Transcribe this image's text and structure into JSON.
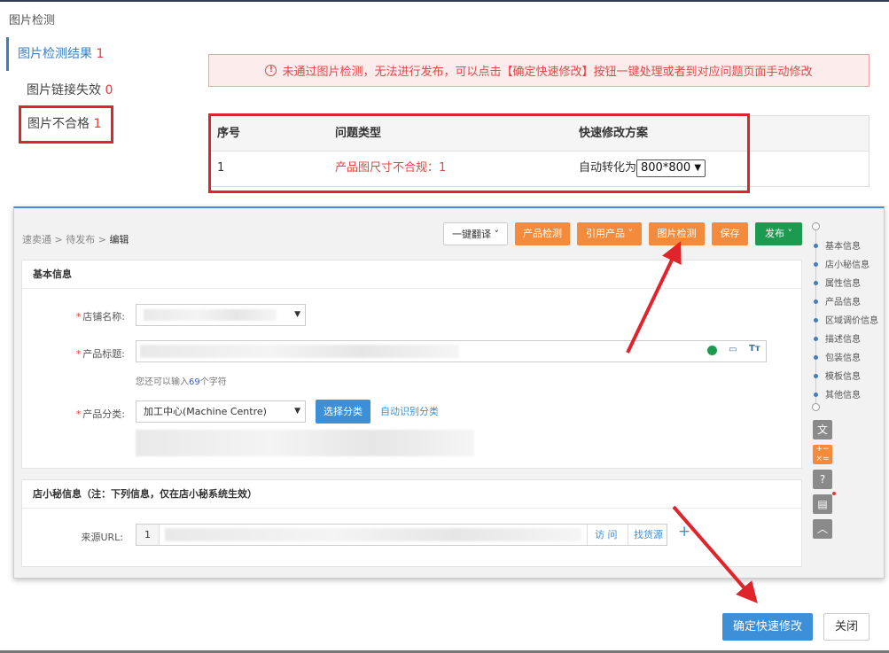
{
  "dialog": {
    "title": "图片检测",
    "nav": {
      "result_label": "图片检测结果",
      "result_count": "1",
      "link_fail_label": "图片链接失效",
      "link_fail_count": "0",
      "unqualified_label": "图片不合格",
      "unqualified_count": "1"
    },
    "alert": "未通过图片检测，无法进行发布，可以点击【确定快速修改】按钮一键处理或者到对应问题页面手动修改",
    "table": {
      "headers": [
        "序号",
        "问题类型",
        "快速修改方案"
      ],
      "rows": [
        {
          "index": "1",
          "issue": "产品图尺寸不合规：1",
          "fix_prefix": "自动转化为",
          "fix_value": "800*800"
        }
      ]
    },
    "confirm_button": "确定快速修改",
    "close_button": "关闭"
  },
  "editor": {
    "breadcrumb": [
      "速卖通",
      "待发布",
      "编辑"
    ],
    "toolbar": {
      "translate": "一键翻译",
      "product_check": "产品检测",
      "cite_product": "引用产品",
      "image_check": "图片检测",
      "save": "保存",
      "publish": "发布"
    },
    "basic_info": {
      "title": "基本信息",
      "store_label": "店铺名称:",
      "product_title_label": "产品标题:",
      "remaining_prefix": "您还可以输入",
      "remaining_count": "69",
      "remaining_suffix": "个字符",
      "category_label": "产品分类:",
      "category_value": "加工中心(Machine Centre)",
      "choose_category": "选择分类",
      "auto_category": "自动识别分类"
    },
    "secretary": {
      "title": "店小秘信息（注：下列信息，仅在店小秘系统生效）",
      "source_url_label": "来源URL:",
      "url_index": "1",
      "visit": "访 问",
      "find_source": "找货源",
      "add": "+"
    },
    "side_nav": [
      "基本信息",
      "店小秘信息",
      "属性信息",
      "产品信息",
      "区域调价信息",
      "描述信息",
      "包装信息",
      "模板信息",
      "其他信息"
    ]
  },
  "colors": {
    "accent": "#3d8fd8",
    "orange": "#f48b3c",
    "green": "#1d9a50",
    "error": "#e04848",
    "highlight": "#e0242b"
  }
}
